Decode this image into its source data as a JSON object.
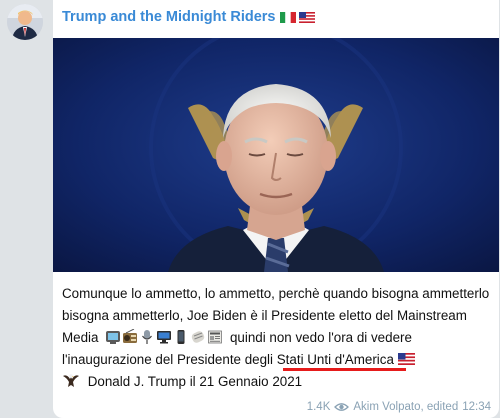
{
  "channel": {
    "title": "Trump and the Midnight Riders",
    "flags": [
      "italy-flag-icon",
      "usa-flag-icon"
    ]
  },
  "post": {
    "text_part1": "Comunque lo ammetto, lo ammetto, perchè quando bisogna ammetterlo bisogna ammetterlo, Joe Biden è il Presidente eletto del Mainstream Media",
    "text_part2": "quindi non vedo l'ora di vedere l'inaugurazione del Presidente degli",
    "link_text": "Stati Unti d'America",
    "text_part3": "Donald J. Trump il 21 Gennaio 2021",
    "media_emojis": [
      "tv-icon",
      "radio-icon",
      "microphone-icon",
      "computer-icon",
      "mobile-phone-icon",
      "newspaper-roll-icon",
      "newspaper-icon"
    ]
  },
  "meta": {
    "views": "1.4K",
    "author": "Akim Volpato, edited",
    "time": "12:34"
  },
  "colors": {
    "accent": "#3a8ad6",
    "underline": "#e61b1b",
    "meta": "#8aa2b4"
  }
}
